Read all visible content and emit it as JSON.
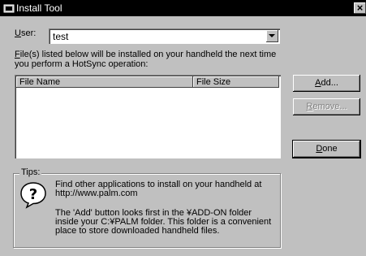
{
  "window": {
    "title": "Install Tool",
    "close_glyph": "×"
  },
  "user": {
    "label_accel": "U",
    "label_rest": "ser:",
    "value": "test"
  },
  "description": {
    "accel": "F",
    "line1_rest": "ile(s) listed below will be installed on your handheld the next time",
    "line2": "you perform a HotSync operation:"
  },
  "file_list": {
    "columns": [
      "File Name",
      "File Size"
    ],
    "rows": []
  },
  "buttons": {
    "add": {
      "accel": "A",
      "rest": "dd..."
    },
    "remove": {
      "accel": "R",
      "rest": "emove..."
    },
    "done": {
      "accel": "D",
      "rest": "one"
    }
  },
  "tips": {
    "label": "Tips:",
    "icon": "help-question-icon",
    "line1": "Find other applications to install on your handheld at",
    "line2": "http://www.palm.com",
    "para2_1": "The 'Add' button looks first in the ¥ADD-ON folder",
    "para2_2": "inside your C:¥PALM folder. This folder is a convenient",
    "para2_3": "place to store downloaded handheld files."
  },
  "colors": {
    "face": "#c0c0c0",
    "titlebar": "#000000",
    "disabled_text": "#808080"
  }
}
